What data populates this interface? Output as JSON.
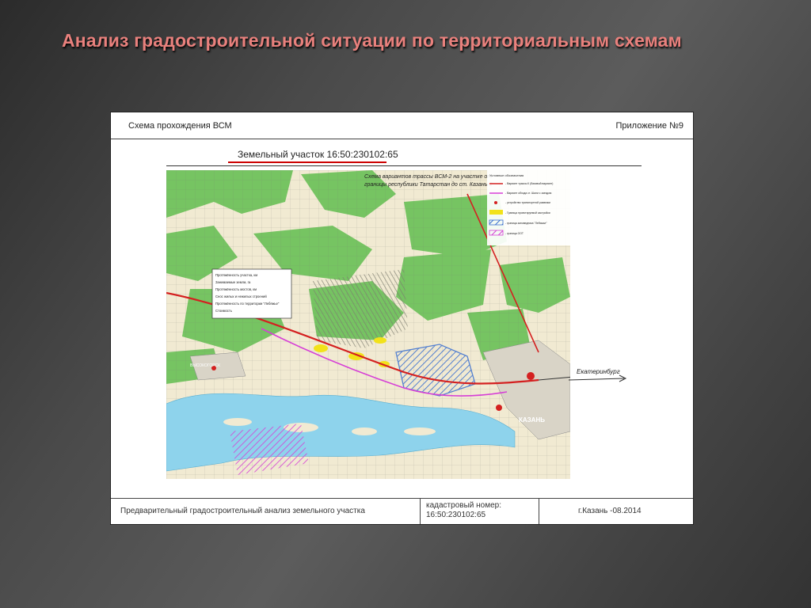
{
  "slide": {
    "title": "Анализ градостроительной ситуации по территориальным схемам"
  },
  "sheet": {
    "header_left": "Схема прохождения ВСМ",
    "header_right": "Приложение №9",
    "plot_label": "Земельный участок 16:50:230102:65",
    "map": {
      "caption_line1": "Схема вариантов трассы ВСМ-2 на участке от",
      "caption_line2": "границы республики Татарстан до ст. Казань-2",
      "legend_title": "Условные обозначения",
      "legend_items": [
        "- Вариант трассы II (базовый вариант)",
        "- Вариант обхода ст. Шали с заездом",
        "- устройство транспортной развязки",
        "- Граница проектируемой застройки",
        "- граница заповедника \"Лебяжье\"",
        "- граница ООТ"
      ],
      "info_box_rows": [
        "Протяжённость участка, км",
        "Занимаемые земли, га",
        "Протяжённость мостов, км",
        "Снос жилых и нежилых строений",
        "Протяжённость по территории \"Лебяжье\"",
        "Стоимость"
      ],
      "place_labels": {
        "city": "КАЗАНЬ",
        "direction": "Екатеринбург",
        "town": "ВЫСОКОГОРСК"
      }
    },
    "footer": {
      "title": "Предварительный градостроительный анализ земельного участка",
      "cadastral_label": "кадастровый номер:",
      "cadastral_number": "16:50:230102:65",
      "place_date": "г.Казань -08.2014"
    }
  },
  "colors": {
    "title": "#e9817d",
    "forest": "#76c462",
    "water": "#8ed3ec",
    "route_red": "#d42020",
    "route_magenta": "#d63fd6",
    "project_zone": "#3a6fd0",
    "highlight_yellow": "#f2e21a"
  }
}
